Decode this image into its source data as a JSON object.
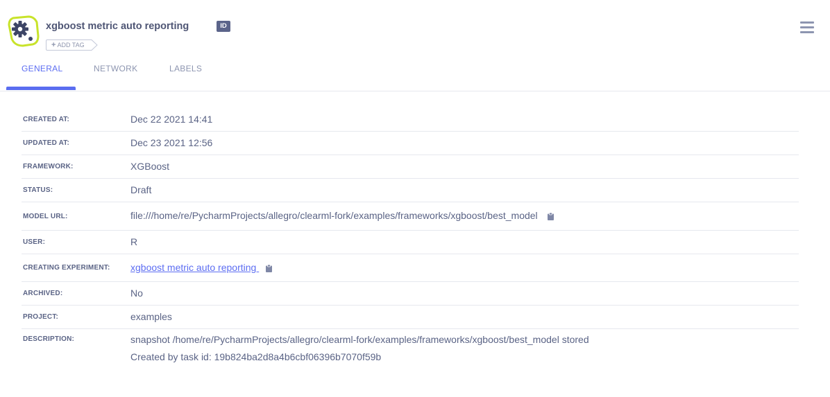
{
  "header": {
    "title": "xgboost metric auto reporting",
    "id_badge": "ID",
    "add_tag_label": "ADD TAG",
    "add_tag_icon": "plus-icon",
    "menu_icon": "hamburger-menu-icon",
    "model_icon": "model-gear-icon",
    "accent_color": "#c8e32a"
  },
  "tabs": [
    {
      "label": "GENERAL",
      "active": true
    },
    {
      "label": "NETWORK",
      "active": false
    },
    {
      "label": "LABELS",
      "active": false
    }
  ],
  "colors": {
    "active_tab": "#5c6df2",
    "inactive_tab": "#8d95b0",
    "text": "#5a6385",
    "divider": "#e6e8ee",
    "badge_bg": "#5b648a"
  },
  "properties": {
    "created_at": {
      "label": "CREATED AT:",
      "value": "Dec 22 2021 14:41"
    },
    "updated_at": {
      "label": "UPDATED AT:",
      "value": "Dec 23 2021 12:56"
    },
    "framework": {
      "label": "FRAMEWORK:",
      "value": "XGBoost"
    },
    "status": {
      "label": "STATUS:",
      "value": "Draft"
    },
    "model_url": {
      "label": "MODEL URL:",
      "value": "file:///home/re/PycharmProjects/allegro/clearml-fork/examples/frameworks/xgboost/best_model",
      "icon": "clipboard-icon"
    },
    "user": {
      "label": "USER:",
      "value": "R"
    },
    "creating_experiment": {
      "label": "CREATING EXPERIMENT:",
      "value": "xgboost metric auto reporting ",
      "icon": "clipboard-icon"
    },
    "archived": {
      "label": "ARCHIVED:",
      "value": "No"
    },
    "project": {
      "label": "PROJECT:",
      "value": "examples"
    },
    "description": {
      "label": "DESCRIPTION:",
      "lines": [
        "snapshot /home/re/PycharmProjects/allegro/clearml-fork/examples/frameworks/xgboost/best_model stored",
        "Created by task id: 19b824ba2d8a4b6cbf06396b7070f59b"
      ]
    }
  }
}
